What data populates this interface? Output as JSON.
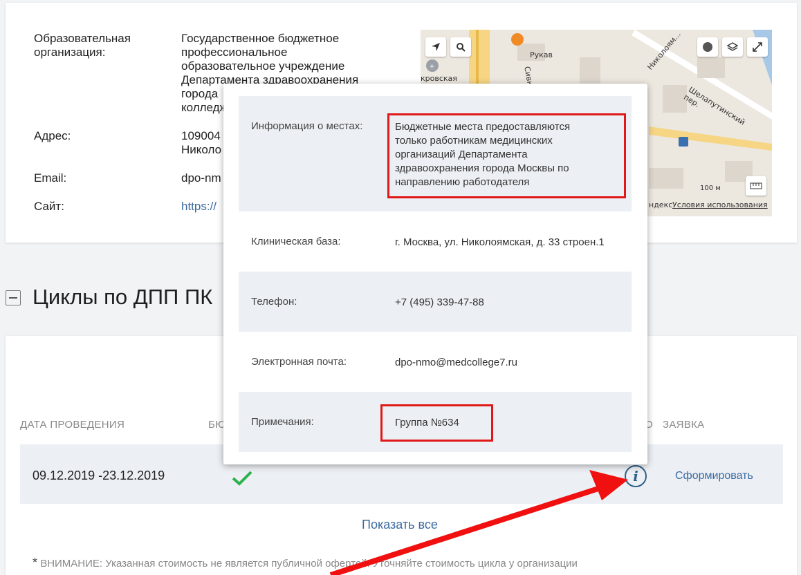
{
  "org": {
    "rows": [
      {
        "label": "Образовательная организация:",
        "value": "Государственное бюджетное профессиональное образовательное учреждение Департамента здравоохранения города ... колледж"
      },
      {
        "label": "Адрес:",
        "value": "109004 ... Николо..."
      },
      {
        "label": "Email:",
        "value": "dpo-nm..."
      },
      {
        "label": "Сайт:",
        "value": "https://..."
      }
    ],
    "label_org_1": "Образовательная",
    "label_org_2": "организация:",
    "value_org_1": "Государственное бюджетное",
    "value_org_2": "профессиональное",
    "value_org_3": "образовательное учреждение",
    "value_org_4": "Департамента здравоохранения",
    "value_org_5": "города",
    "value_org_6": "колледж",
    "label_address": "Адрес:",
    "value_address_1": "109004",
    "value_address_2": "Николо",
    "label_email": "Email:",
    "value_email": "dpo-nm",
    "label_site": "Сайт:",
    "value_site": "https://"
  },
  "map": {
    "labels": {
      "rukav": "Рукав",
      "sivkov": "Сивков",
      "krovskaya": "кровская",
      "nikolo": "Николоям...",
      "shelaputinsky": "Шелапутинский пер.",
      "scale": "100 м",
      "yandex": "ндекс",
      "terms": "Условия использования"
    },
    "buttons": [
      "location-icon",
      "search-icon",
      "traffic-icon",
      "layers-icon",
      "fullscreen-icon",
      "ruler-icon"
    ]
  },
  "section": {
    "title": "Циклы по ДПП ПК"
  },
  "table": {
    "headers": {
      "date": "ДАТА ПРОВЕДЕНИЯ",
      "budget": "БЮ",
      "price": "О",
      "request": "ЗАЯВКА"
    },
    "row": {
      "date": "09.12.2019 -23.12.2019",
      "budget_check": "✓",
      "info": "i",
      "action": "Сформировать"
    },
    "show_all": "Показать все",
    "warning_star": "*",
    "warning": "ВНИМАНИЕ: Указанная стоимость не является публичной офертой! Уточняйте стоимость цикла у организации"
  },
  "popup": {
    "places_label": "Информация о местах:",
    "places_value_1": "Бюджетные места предоставляются",
    "places_value_2": "только работникам медицинских",
    "places_value_3": "организаций Департамента",
    "places_value_4": "здравоохранения города Москвы по",
    "places_value_5": "направлению работодателя",
    "clinic_label": "Клиническая база:",
    "clinic_value": "г. Москва, ул. Николоямская, д. 33 строен.1",
    "phone_label": "Телефон:",
    "phone_value": "+7 (495) 339-47-88",
    "email_label": "Электронная почта:",
    "email_value": "dpo-nmo@medcollege7.ru",
    "notes_label": "Примечания:",
    "notes_value": "Группа №634"
  },
  "colors": {
    "accent_link": "#3b6aa0",
    "highlight": "#e01818",
    "check": "#2bb24c",
    "row_bg": "#eceff3"
  }
}
